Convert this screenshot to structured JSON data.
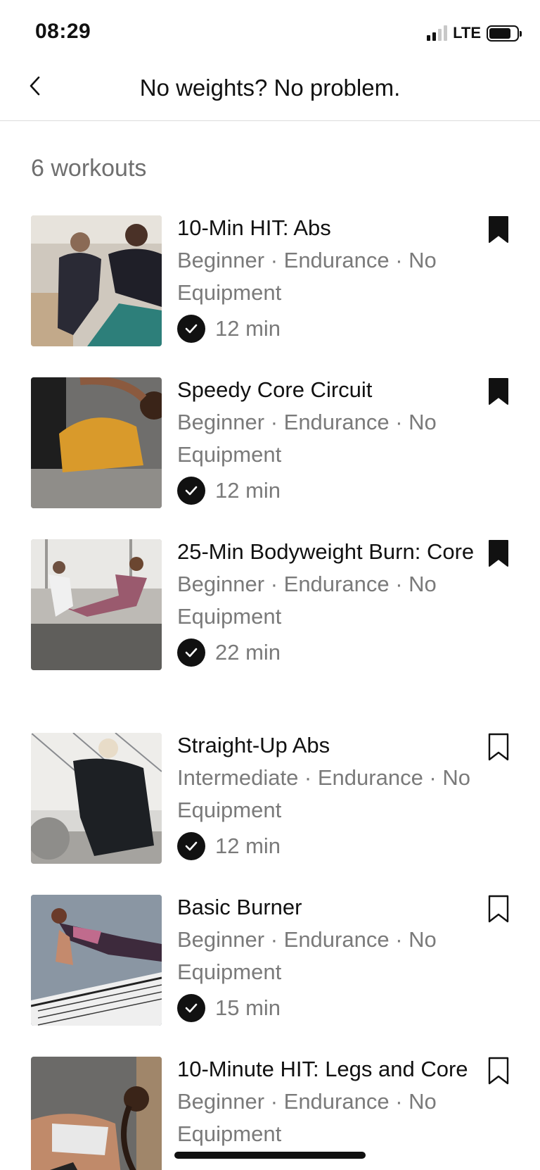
{
  "status_bar": {
    "time": "08:29",
    "network": "LTE",
    "signal_bars_filled": 2,
    "signal_bars_total": 4
  },
  "header": {
    "back_icon": "chevron-left-icon",
    "title": "No weights? No problem."
  },
  "summary": {
    "count_label": "6 workouts"
  },
  "workouts": [
    {
      "title": "10-Min HIT: Abs",
      "meta": "Beginner · Endurance · No Equipment",
      "duration": "12 min",
      "completed": true,
      "saved": true
    },
    {
      "title": "Speedy Core Circuit",
      "meta": "Beginner · Endurance · No Equipment",
      "duration": "12 min",
      "completed": true,
      "saved": true
    },
    {
      "title": "25-Min Bodyweight Burn: Core",
      "meta": "Beginner · Endurance · No Equipment",
      "duration": "22 min",
      "completed": true,
      "saved": true
    },
    {
      "title": "Straight-Up Abs",
      "meta": "Intermediate · Endurance · No Equipment",
      "duration": "12 min",
      "completed": true,
      "saved": false
    },
    {
      "title": "Basic Burner",
      "meta": "Beginner · Endurance · No Equipment",
      "duration": "15 min",
      "completed": true,
      "saved": false
    },
    {
      "title": "10-Minute HIT: Legs and Core",
      "meta": "Beginner · Endurance · No Equipment",
      "duration": "",
      "completed": false,
      "saved": false
    }
  ],
  "colors": {
    "text": "#111111",
    "muted": "#7a7a7a",
    "divider": "#dcdcdc",
    "background": "#ffffff"
  }
}
